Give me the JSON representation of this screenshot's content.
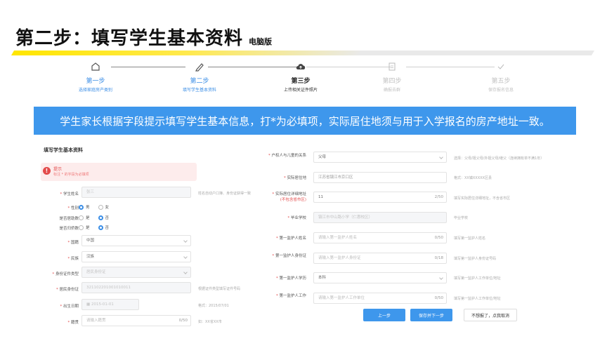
{
  "slide": {
    "title": "第二步：填写学生基本资料",
    "subtitle": "电脑版"
  },
  "steps": [
    {
      "title": "第一步",
      "desc": "选择家庭房产类别"
    },
    {
      "title": "第二步",
      "desc": "填写学生基本资料"
    },
    {
      "title": "第三步",
      "desc": "上传相关证件照片"
    },
    {
      "title": "第四步",
      "desc": "确报去群"
    },
    {
      "title": "第五步",
      "desc": "保存报名信息"
    }
  ],
  "banner": "学生家长根据字段提示填写学生基本信息，打*为必填项，实际居住地须与用于入学报名的房产地址一致。",
  "left_form": {
    "title": "填写学生基本资料",
    "tip": {
      "title": "提示",
      "text": "标注 * 的字段为必填项"
    },
    "name": {
      "label": "学生姓名",
      "value": "张三",
      "hint": "姓名自动户口簿、身份证获得一致"
    },
    "gender": {
      "label": "性别",
      "options": [
        "男",
        "女"
      ]
    },
    "resident": {
      "label": "是否居助数",
      "options": [
        "是",
        "否"
      ]
    },
    "returned": {
      "label": "是否归侨数",
      "options": [
        "是",
        "否"
      ]
    },
    "nationality": {
      "label": "国籍",
      "value": "中国"
    },
    "ethnic": {
      "label": "民族",
      "value": "汉族"
    },
    "id_type": {
      "label": "身份证件类型",
      "value": "居民身份证"
    },
    "id_number": {
      "label": "居民身份证",
      "value": "321102201001010011",
      "hint": "根据证件类型填写证件号码"
    },
    "birth": {
      "label": "出生日期",
      "value": "2015-01-01",
      "hint": "格式：2015/07/01"
    },
    "nick": {
      "label": "籍贯",
      "placeholder": "请输入籍贯",
      "count": "0/50",
      "hint": "如：XX省XX市"
    }
  },
  "right_form": {
    "relation": {
      "label": "户权人与儿童的关系",
      "value": "父母",
      "hint": "选择：父母/祖父母/外祖父母/继父（连续拥有单不满1年）"
    },
    "address": {
      "label": "实际居住地",
      "value": "江苏省镇江市京口区",
      "hint": "格式：XX镇XXXXX区县"
    },
    "detail": {
      "label": "实际居住详细地址",
      "label_note": "(不包含省市区)",
      "value": "11",
      "count": "2/50",
      "hint": "填写实际居住详细地址，不含省市区"
    },
    "school": {
      "label": "毕业学校",
      "value": "镇江市中山路小学（仁惠校区）",
      "hint": "毕业学校"
    },
    "guardian_name": {
      "label": "第一监护人姓名",
      "placeholder": "请输入第一监护人姓名",
      "count": "0/50",
      "hint": "填写第一监护人姓名"
    },
    "guardian_id": {
      "label": "第一监护人身份证",
      "placeholder": "请输入第一监护人身份证",
      "count": "0/18",
      "hint": "填写第一监护人身份证号码"
    },
    "guardian_edu": {
      "label": "第一监护人学历",
      "value": "本科",
      "hint": "填写第一监护人工作单位/地址"
    },
    "guardian_work": {
      "label": "第一监护人工作",
      "placeholder": "请输入第一监护人工作单位",
      "count": "0/50",
      "hint": "填写第一监护人工作单位/地址"
    }
  },
  "buttons": {
    "prev": "上一步",
    "next": "保存并下一步",
    "cancel": "不想报了，点我取消"
  },
  "colors": {
    "primary": "#3e97ec",
    "required": "#e34b4b",
    "title_highlight": "#ffe600"
  }
}
